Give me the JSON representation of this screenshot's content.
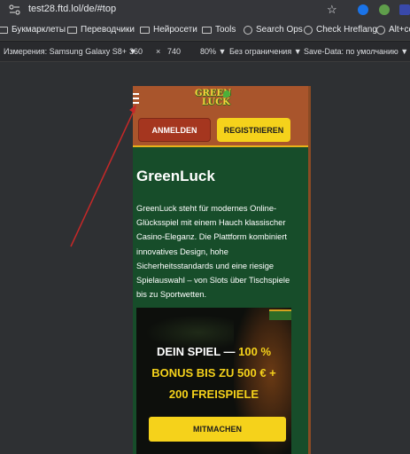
{
  "browser": {
    "url": "test28.ftd.lol/de/#top",
    "icons": [
      "site-info-icon",
      "star-icon",
      "extension-icon"
    ]
  },
  "bookmarks": [
    {
      "label": "Букмарклеты",
      "icon": "folder-icon"
    },
    {
      "label": "Переводчики",
      "icon": "folder-icon"
    },
    {
      "label": "Нейросети",
      "icon": "folder-icon"
    },
    {
      "label": "Tools",
      "icon": "folder-icon"
    },
    {
      "label": "Search Ops",
      "icon": "globe-icon"
    },
    {
      "label": "Check Hreflang",
      "icon": "globe-icon"
    },
    {
      "label": "Alt+co",
      "icon": "globe-icon"
    }
  ],
  "devtools": {
    "device_label": "Измерения: Samsung Galaxy S8+ ▼",
    "width": "360",
    "times": "×",
    "height": "740",
    "zoom": "80% ▼",
    "throttle": "Без ограничения ▼",
    "save_data": "Save-Data: по умолчанию ▼"
  },
  "site": {
    "logo": {
      "line1": "GREEN",
      "line2": "LUCK"
    },
    "login_button": "ANMELDEN",
    "register_button": "REGISTRIEREN",
    "title": "GreenLuck",
    "intro": "GreenLuck steht für modernes Online-Glücksspiel mit einem Hauch klassischer Casino-Eleganz. Die Plattform kombiniert innovatives Design, hohe Sicherheitsstandards und eine riesige Spielauswahl – von Slots über Tischspiele bis zu Sportwetten.",
    "promo": {
      "line1_text": "DEIN SPIEL — ",
      "line1_highlight": "100 %",
      "line2": "BONUS BIS ZU 500 € +",
      "line3": "200 FREISPIELE",
      "cta": "MITMACHEN"
    }
  },
  "colors": {
    "header_bg": "#a9552c",
    "site_bg": "#174d2a",
    "accent_yellow": "#f5d21b",
    "login_red": "#a5361f",
    "annotation_arrow": "#c62828"
  }
}
